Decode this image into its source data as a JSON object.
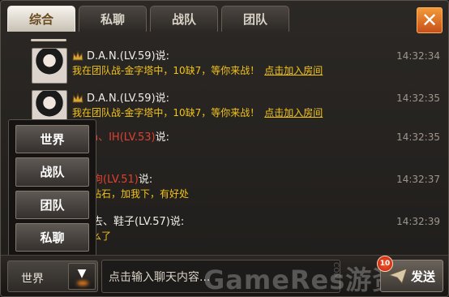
{
  "tabs": [
    {
      "label": "综合",
      "active": true
    },
    {
      "label": "私聊",
      "active": false
    },
    {
      "label": "战队",
      "active": false
    },
    {
      "label": "团队",
      "active": false
    }
  ],
  "close_label": "✕",
  "messages": [
    {
      "sender": "D.A.N.(LV.59)",
      "said": "说:",
      "text": "我在团队战-金字塔中，10缺7，等你来战！",
      "link": "点击加入房间",
      "time": "14:32:34",
      "has_avatar": true,
      "sender_color": "#f0ede7"
    },
    {
      "sender": "D.A.N.(LV.59)",
      "said": "说:",
      "text": "我在团队战-金字塔中，10缺7，等你来战！",
      "link": "点击加入房间",
      "time": "14:32:35",
      "has_avatar": true,
      "sender_color": "#f0ede7"
    },
    {
      "sender": "Sin、IH(LV.53)",
      "said": "说:",
      "text": "",
      "link": "",
      "time": "14:32:35",
      "has_avatar": false,
      "sender_color": "#e0402f"
    },
    {
      "sender": "丝狗(LV.51)",
      "said": "说:",
      "text": "刷钻石，加我下，有好处",
      "link": "",
      "time": "14:32:37",
      "has_avatar": false,
      "sender_color": "#e0402f"
    },
    {
      "sender": "我去、鞋子(LV.57)",
      "said": "说:",
      "text": "怎么了",
      "link": "",
      "time": "14:32:39",
      "has_avatar": false,
      "sender_color": "#f0ede7"
    }
  ],
  "channel_options": [
    "世界",
    "战队",
    "团队",
    "私聊"
  ],
  "input": {
    "channel": "世界",
    "placeholder": "点击输入聊天内容...",
    "send_label": "发送",
    "badge": "10"
  },
  "watermark": "GameRes游资网",
  "watermark_small": "COM",
  "colors": {
    "accent_orange": "#e57a1c",
    "message_yellow": "#f2c31a",
    "sender_red": "#e0402f",
    "timestamp": "#9f968b"
  }
}
